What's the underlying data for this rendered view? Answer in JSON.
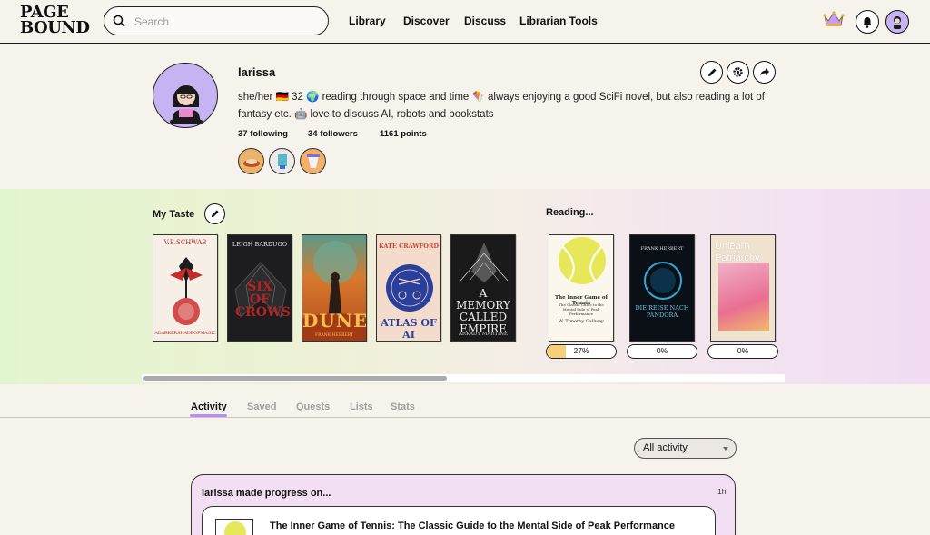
{
  "header": {
    "logo_line1": "PAGE",
    "logo_line2": "BOUND",
    "search_placeholder": "Search",
    "nav": [
      "Library",
      "Discover",
      "Discuss",
      "Librarian Tools"
    ],
    "icons": [
      "crown-icon",
      "bell-icon",
      "user-avatar"
    ]
  },
  "profile": {
    "username": "larissa",
    "bio": "she/her 🇩🇪 32 🌍 reading through space and time 🪁 always enjoying a good SciFi novel, but also reading a lot of fantasy etc. 🤖 love to discuss AI, robots and bookstats",
    "following": "37 following",
    "followers": "34 followers",
    "points": "1161 points",
    "actions": [
      "edit-icon",
      "gear-icon",
      "share-icon"
    ]
  },
  "taste": {
    "title": "My Taste",
    "books": [
      {
        "author": "V.E.SCHWAB",
        "title": "ADARKERSHADEOFMAGIC",
        "bg": "#f6efe6"
      },
      {
        "author": "LEIGH BARDUGO",
        "title": "SIX OF CROWS",
        "bg": "#1d1d1f"
      },
      {
        "author": "FRANK HERBERT",
        "title": "DUNE",
        "bg": "#d77a2c"
      },
      {
        "author": "KATE CRAWFORD",
        "title": "ATLAS OF AI",
        "bg": "#f4dccd"
      },
      {
        "author": "ARKADY MARTINE",
        "title": "A MEMORY CALLED EMPIRE",
        "bg": "#1a1a1a"
      }
    ]
  },
  "reading": {
    "title": "Reading...",
    "books": [
      {
        "title": "The Inner Game of Tennis",
        "subtitle": "The Classic Guide to the Mental Side of Peak Performance",
        "author": "W. Timothy Gallwey",
        "progress": 27,
        "label": "27%"
      },
      {
        "author": "FRANK HERBERT",
        "title": "DIE REISE NACH PANDORA",
        "progress": 0,
        "label": "0%"
      },
      {
        "title": "Unlearn Patriarchy",
        "progress": 0,
        "label": "0%"
      }
    ]
  },
  "tabs": [
    "Activity",
    "Saved",
    "Quests",
    "Lists",
    "Stats"
  ],
  "filter": {
    "selected": "All activity"
  },
  "activity": {
    "headline": "larissa made progress on...",
    "time": "1h",
    "book_title": "The Inner Game of Tennis: The Classic Guide to the Mental Side of Peak Performance"
  },
  "colors": {
    "accent": "#b88cf0",
    "card_bg": "#f2dff4",
    "progress_fill": "#f5cf7a",
    "avatar_bg": "#c6b3f1"
  }
}
